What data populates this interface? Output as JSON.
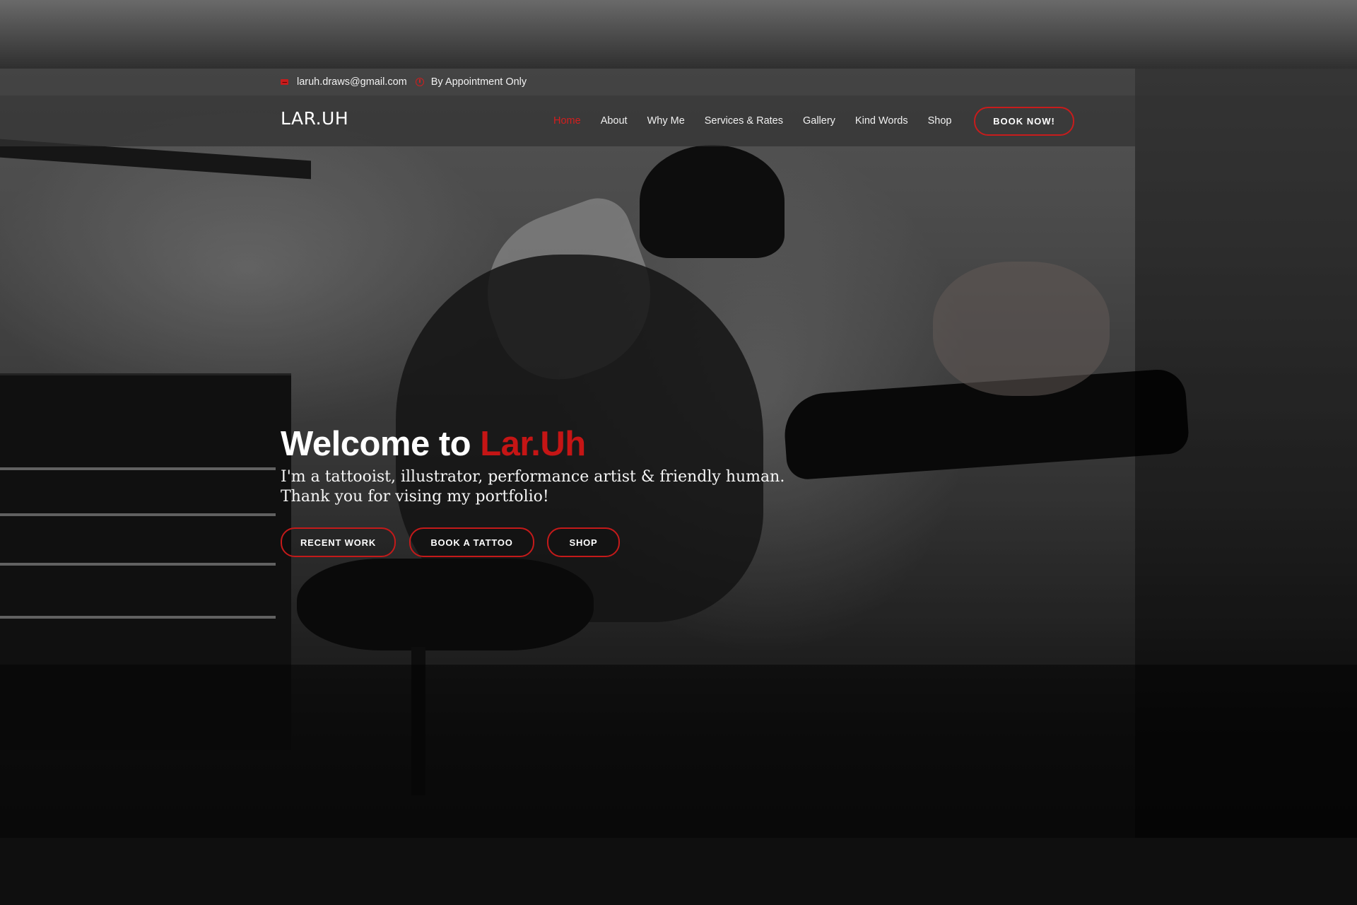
{
  "topbar": {
    "email": "laruh.draws@gmail.com",
    "hours": "By Appointment Only",
    "email_icon": "envelope-icon",
    "hours_icon": "clock-icon"
  },
  "header": {
    "logo": "LAR.UH",
    "nav": [
      "Home",
      "About",
      "Why Me",
      "Services & Rates",
      "Gallery",
      "Kind Words",
      "Shop"
    ],
    "active_nav": "Home",
    "cta": "BOOK NOW!"
  },
  "hero": {
    "title_prefix": "Welcome to ",
    "title_highlight": "Lar.Uh",
    "subtitle_line1": "I'm a tattooist, illustrator, performance artist & friendly human.",
    "subtitle_line2": "Thank you for vising my portfolio!",
    "buttons": [
      "RECENT WORK",
      "BOOK A TATTOO",
      "SHOP"
    ]
  },
  "colors": {
    "accent": "#c81c1c",
    "text": "#ffffff",
    "nav_background": "#323232"
  }
}
